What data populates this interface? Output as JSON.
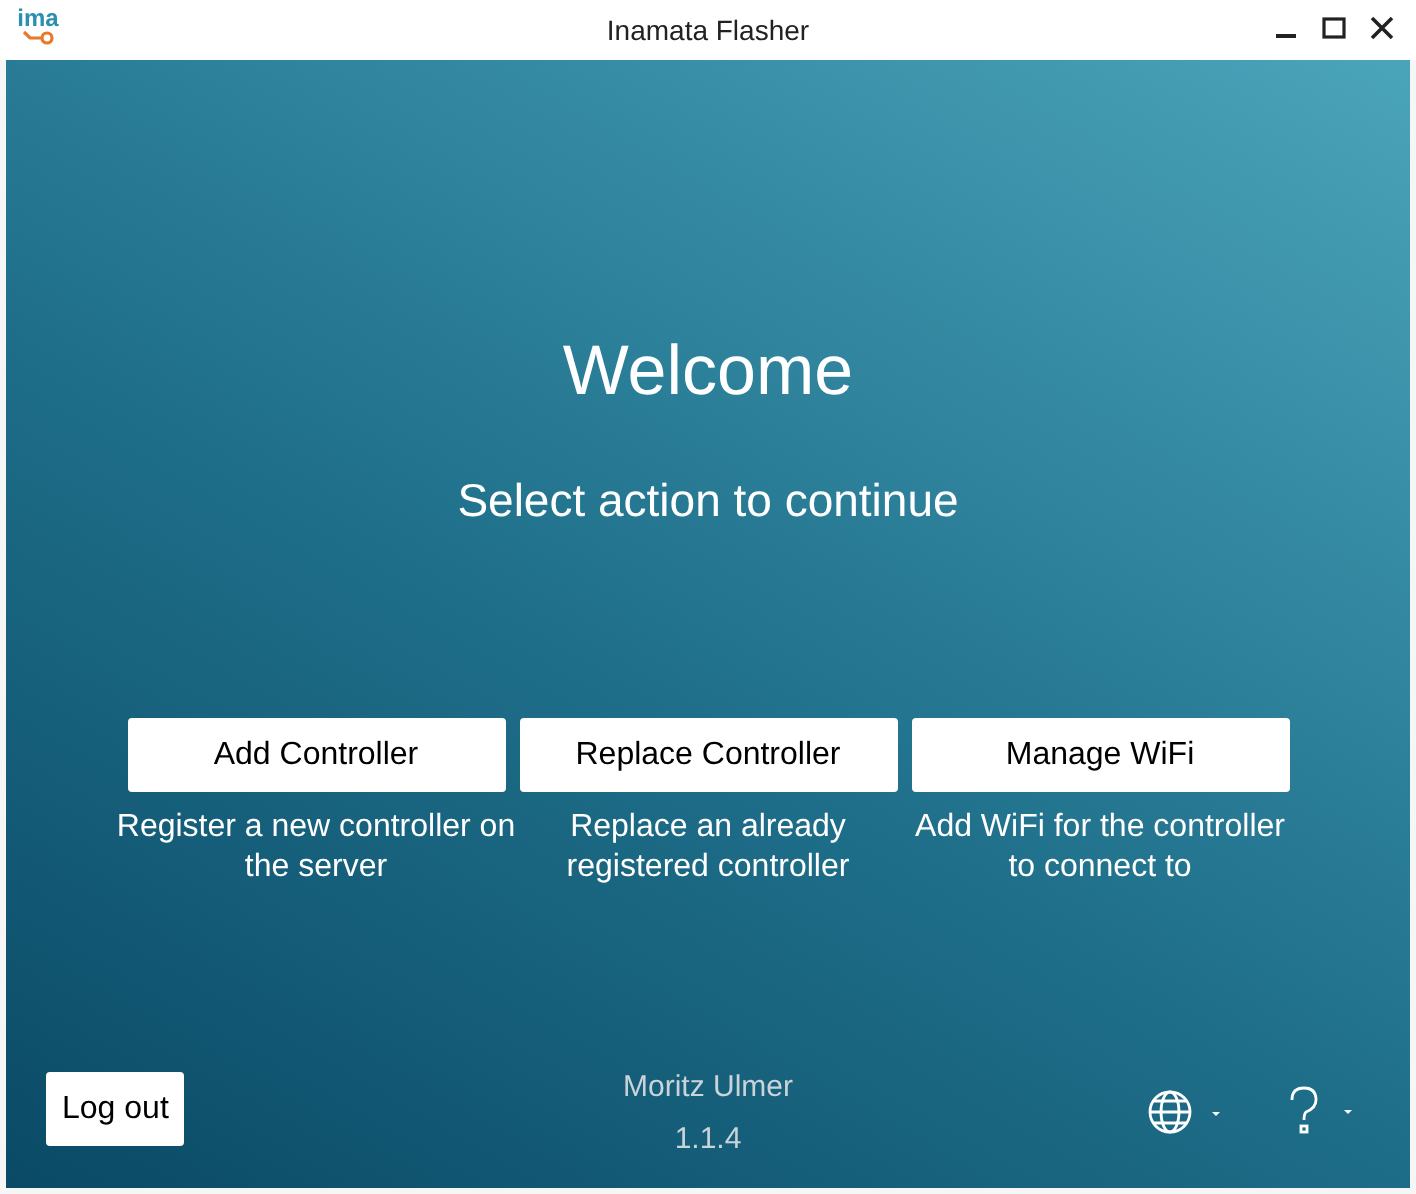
{
  "window": {
    "title": "Inamata Flasher",
    "logo_text": "ima"
  },
  "heading": "Welcome",
  "subtitle": "Select action to continue",
  "actions": [
    {
      "label": "Add Controller",
      "description": "Register a new controller on the server"
    },
    {
      "label": "Replace Controller",
      "description": "Replace an already registered controller"
    },
    {
      "label": "Manage WiFi",
      "description": "Add WiFi for the controller to connect to"
    }
  ],
  "footer": {
    "logout": "Log out",
    "user": "Moritz Ulmer",
    "version": "1.1.4"
  }
}
